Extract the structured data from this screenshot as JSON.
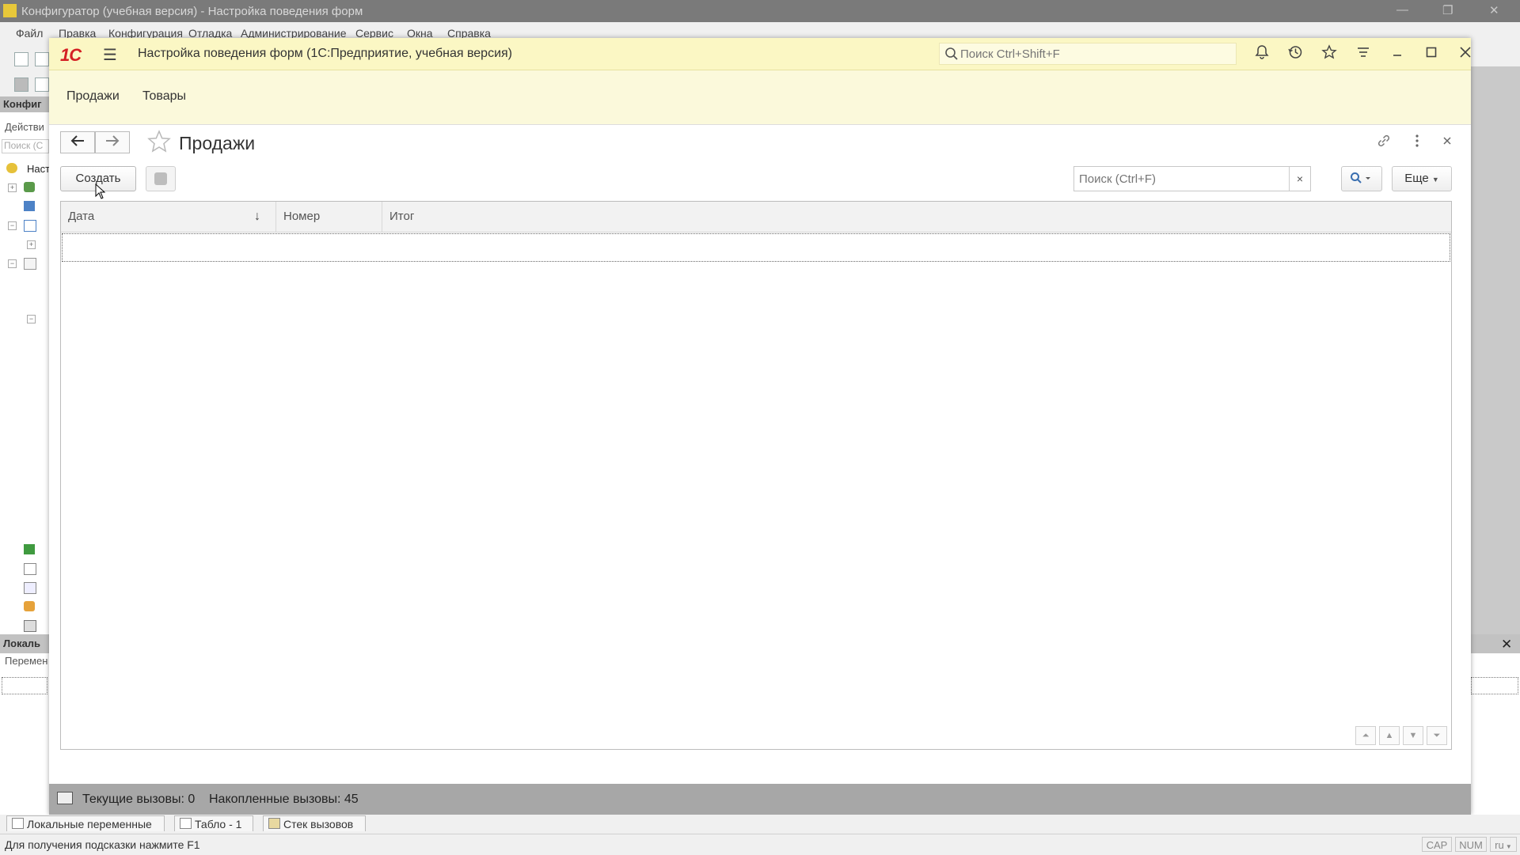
{
  "outer_window": {
    "title": "Конфигуратор (учебная версия) - Настройка поведения форм",
    "controls": [
      "—",
      "❐",
      "✕"
    ]
  },
  "outer_menu": [
    "Файл",
    "Правка",
    "Конфигурация",
    "Отладка",
    "Администрирование",
    "Сервис",
    "Окна",
    "Справка"
  ],
  "left_panel": {
    "header": "Конфиг",
    "actions": "Действи",
    "search_placeholder": "Поиск (С",
    "tree_root": "Наст",
    "lower_header": "Локаль",
    "lower_sub": "Перемен"
  },
  "app": {
    "logo": "1С",
    "title": "Настройка поведения форм  (1С:Предприятие, учебная версия)",
    "search_placeholder": "Поиск Ctrl+Shift+F",
    "header_icons": [
      "bell-icon",
      "history-icon",
      "star-icon",
      "settings-lines-icon",
      "minimize-icon",
      "maximize-icon",
      "close-icon"
    ],
    "sections": [
      "Продажи",
      "Товары"
    ]
  },
  "form": {
    "title": "Продажи",
    "create_label": "Создать",
    "search_placeholder": "Поиск (Ctrl+F)",
    "clear_label": "×",
    "more_label": "Еще",
    "columns": [
      {
        "label": "Дата",
        "sort": "↓"
      },
      {
        "label": "Номер"
      },
      {
        "label": "Итог"
      }
    ],
    "rows": []
  },
  "app_status": {
    "current_calls": "Текущие вызовы: 0",
    "accumulated_calls": "Накопленные вызовы: 45"
  },
  "bottom_tabs": [
    "Локальные переменные",
    "Табло - 1",
    "Стек вызовов"
  ],
  "statusbar": {
    "hint": "Для получения подсказки нажмите F1",
    "indicators": [
      "CAP",
      "NUM",
      "ru"
    ]
  },
  "colors": {
    "header_bg": "#fbf7c4",
    "logo_red": "#d42024",
    "status_gray": "#a7a7a7"
  }
}
